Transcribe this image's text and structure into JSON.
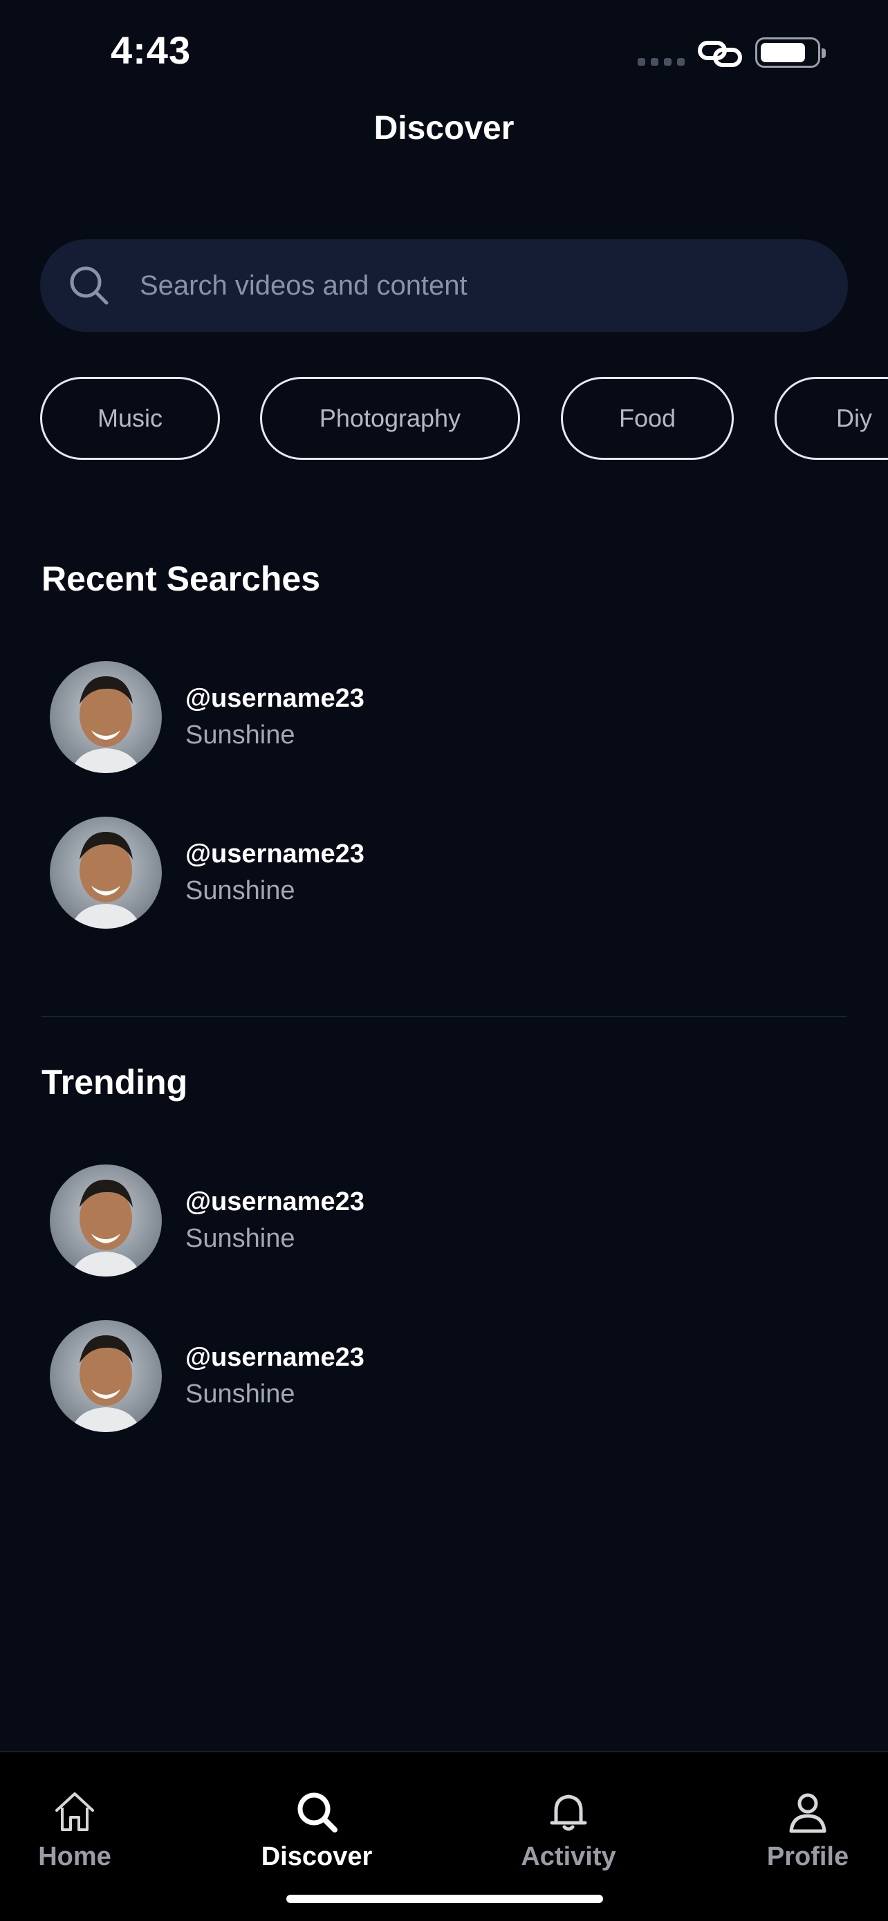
{
  "status_bar": {
    "time": "4:43"
  },
  "header": {
    "title": "Discover"
  },
  "search": {
    "placeholder": "Search videos and content",
    "value": ""
  },
  "categories": [
    "Music",
    "Photography",
    "Food",
    "Diy"
  ],
  "recent_searches": {
    "title": "Recent Searches",
    "items": [
      {
        "username": "@username23",
        "subtitle": "Sunshine"
      },
      {
        "username": "@username23",
        "subtitle": "Sunshine"
      }
    ]
  },
  "trending": {
    "title": "Trending",
    "items": [
      {
        "username": "@username23",
        "subtitle": "Sunshine"
      },
      {
        "username": "@username23",
        "subtitle": "Sunshine"
      }
    ]
  },
  "tab_bar": {
    "tabs": [
      {
        "label": "Home",
        "icon": "home-icon",
        "active": false
      },
      {
        "label": "Discover",
        "icon": "search-icon",
        "active": true
      },
      {
        "label": "Activity",
        "icon": "bell-icon",
        "active": false
      },
      {
        "label": "Profile",
        "icon": "person-icon",
        "active": false
      }
    ]
  },
  "colors": {
    "background": "#070b16",
    "search_bg": "#141d33",
    "chip_border": "#e6e8ee",
    "tab_bar_bg": "#000000",
    "inactive_tab": "#9a9da5"
  }
}
